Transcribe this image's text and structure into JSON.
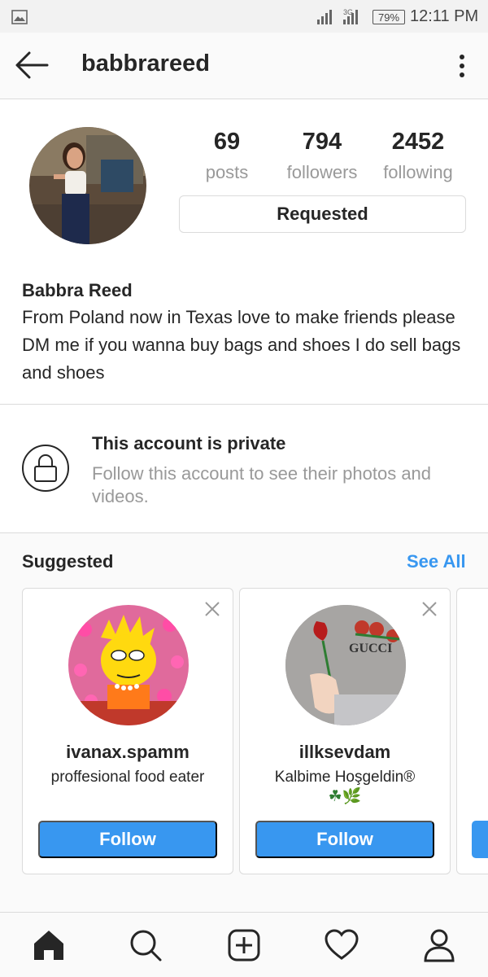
{
  "status_bar": {
    "network_label": "3G",
    "battery": "79%",
    "time": "12:11 PM"
  },
  "header": {
    "username": "babbrareed"
  },
  "profile": {
    "stats": [
      {
        "value": "69",
        "label": "posts"
      },
      {
        "value": "794",
        "label": "followers"
      },
      {
        "value": "2452",
        "label": "following"
      }
    ],
    "requested_label": "Requested",
    "name": "Babbra Reed",
    "bio": "From Poland now in Texas love to make friends please DM me if you wanna buy bags and shoes I do sell bags and shoes"
  },
  "private": {
    "title": "This account is private",
    "subtitle": "Follow this account to see their photos and videos."
  },
  "suggested": {
    "title": "Suggested",
    "see_all": "See All",
    "cards": [
      {
        "username": "ivanax.spamm",
        "description": "proffesional food eater",
        "follow_label": "Follow"
      },
      {
        "username": "illksevdam",
        "description": "Kalbime Hoşgeldin®",
        "emoji": "☘🌿",
        "avatar_text": "GUCCI",
        "follow_label": "Follow"
      }
    ]
  },
  "colors": {
    "accent": "#3897f0",
    "text": "#262626",
    "muted": "#999999",
    "border": "#dbdbdb"
  },
  "icons": [
    "gallery-icon",
    "signal-icon",
    "back-arrow-icon",
    "more-vertical-icon",
    "lock-icon",
    "close-icon",
    "home-icon",
    "search-icon",
    "add-post-icon",
    "heart-icon",
    "profile-icon"
  ]
}
